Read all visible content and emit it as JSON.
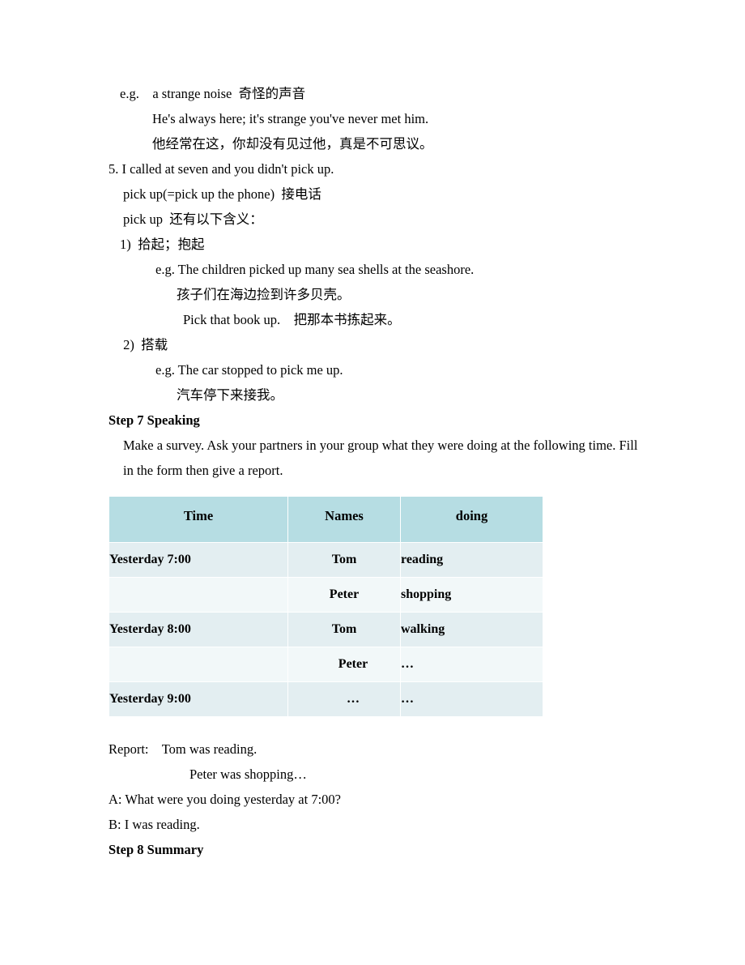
{
  "document": {
    "example_block": {
      "eg_label": "e.g.",
      "line1": "e.g.    a strange noise  奇怪的声音",
      "line2": "He's always here; it's strange you've never met him.",
      "line3": "他经常在这，你却没有见过他，真是不可思议。"
    },
    "item5": {
      "number_line": "5. I called at seven and you didn't pick up.",
      "gloss1": "pick up(=pick up the phone)  接电话",
      "gloss2": "pick up  还有以下含义："
    },
    "sense1": {
      "label": "1)  拾起；抱起",
      "eg": "e.g. The children picked up many sea shells at the seashore.",
      "translation": "孩子们在海边捡到许多贝壳。",
      "eg2": "Pick that book up.    把那本书拣起来。"
    },
    "sense2": {
      "label": " 2)  搭载",
      "eg": "e.g. The car stopped to pick me up.",
      "translation": "汽车停下来接我。"
    },
    "step7": {
      "heading": "Step 7 Speaking",
      "instruction": "Make a survey. Ask your partners in your group what they were doing at the following time. Fill in the form then give a report."
    },
    "survey_table": {
      "headers": [
        "Time",
        "Names",
        "doing"
      ],
      "rows": [
        {
          "time": "Yesterday 7:00",
          "name": "Tom",
          "doing": "reading"
        },
        {
          "time": "",
          "name": "Peter",
          "doing": "shopping"
        },
        {
          "time": "Yesterday 8:00",
          "name": "Tom",
          "doing": "walking"
        },
        {
          "time": "",
          "name": "Peter",
          "doing": "…"
        },
        {
          "time": "Yesterday 9:00",
          "name": "…",
          "doing": "…"
        }
      ]
    },
    "report": {
      "line1": "Report:    Tom was reading.",
      "line2": "Peter was shopping…",
      "dialog_a": "A: What were you doing yesterday at 7:00?",
      "dialog_b": "B: I was reading."
    },
    "step8": {
      "heading": "Step 8 Summary"
    }
  },
  "colors": {
    "table_header_bg": "#b6dde3",
    "table_row_shade": "#e3eef1",
    "table_row_light": "#f2f8f9",
    "text": "#000000",
    "page_bg": "#ffffff"
  }
}
